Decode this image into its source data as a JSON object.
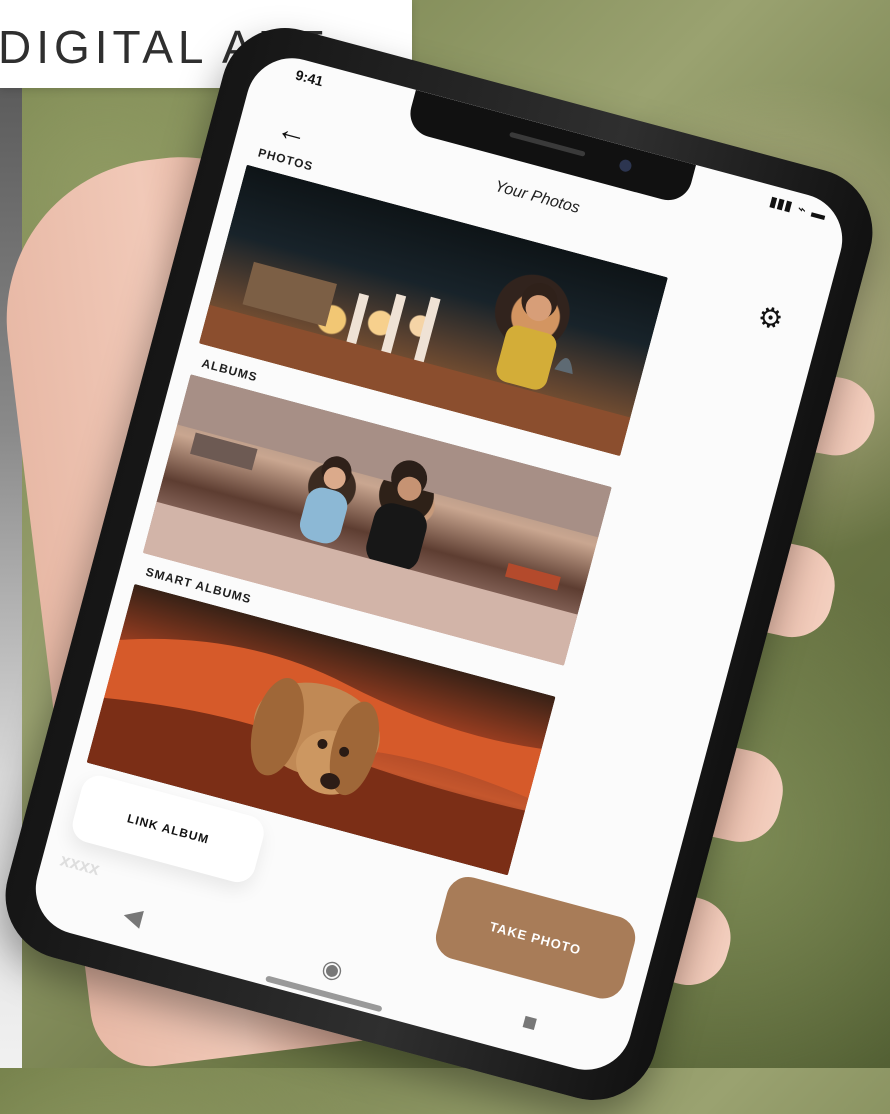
{
  "branding": {
    "title": "DIGITAL ART"
  },
  "phone": {
    "status": {
      "time": "9:41",
      "signal_icon": "signal-bars-icon",
      "wifi_icon": "wifi-icon",
      "battery_icon": "battery-icon"
    },
    "header": {
      "title": "Your Photos",
      "back_icon": "arrow-left-icon",
      "settings_icon": "gear-icon"
    },
    "sections": [
      {
        "label": "PHOTOS"
      },
      {
        "label": "ALBUMS"
      },
      {
        "label": "SMART ALBUMS"
      }
    ],
    "buttons": {
      "link_album": "LINK ALBUM",
      "take_photo": "TAKE PHOTO"
    },
    "navigation": {
      "back_icon": "back-triangle-icon",
      "home_icon": "home-circle-icon",
      "recent_icon": "square-icon"
    }
  }
}
